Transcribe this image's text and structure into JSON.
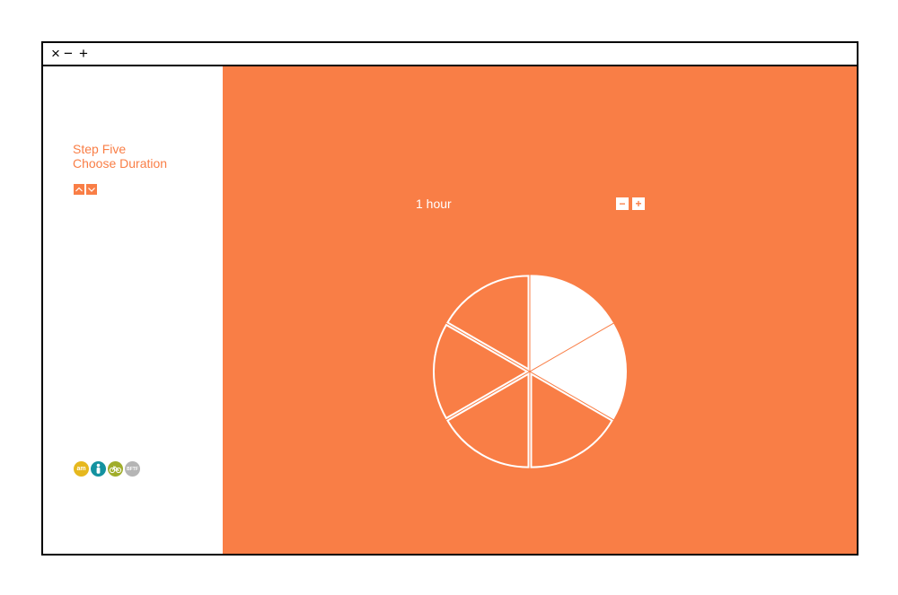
{
  "window": {
    "controls": {
      "close": "×",
      "minimize": "−",
      "maximize": "+"
    }
  },
  "sidebar": {
    "step_line1": "Step Five",
    "step_line2": "Choose Duration",
    "nav": {
      "up_icon": "chevron-up-icon",
      "down_icon": "chevron-down-icon"
    },
    "logos": [
      {
        "text": "am",
        "color": "#e6b81e"
      },
      {
        "text": "",
        "color": "#1492a0",
        "icon": "person-icon"
      },
      {
        "text": "",
        "color": "#a0ad2a",
        "icon": "bicycle-icon"
      },
      {
        "text": "BFTF",
        "color": "#b5b5b5"
      }
    ]
  },
  "main": {
    "background": "#f97e46",
    "duration_label": "1 hour",
    "minus_label": "−",
    "plus_label": "+",
    "pie": {
      "segments_total": 6,
      "segments_selected": 2
    }
  }
}
